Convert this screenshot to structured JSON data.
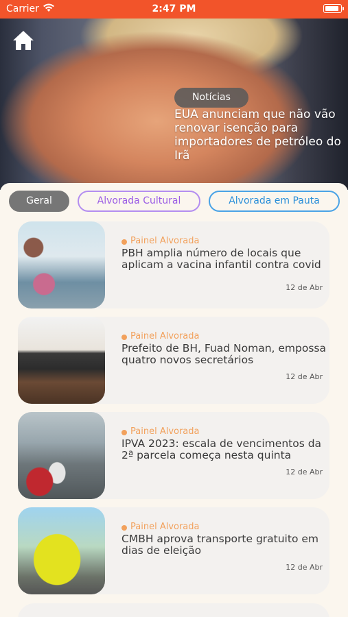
{
  "status_bar": {
    "carrier": "Carrier",
    "time": "2:47 PM"
  },
  "hero": {
    "category": "Notícias",
    "headline": "EUA anunciam que não vão renovar isenção para importadores de petróleo do Irã"
  },
  "filters": [
    {
      "label": "Geral",
      "selected": true
    },
    {
      "label": "Alvorada Cultural",
      "selected": false
    },
    {
      "label": "Alvorada em Pauta",
      "selected": false
    }
  ],
  "news": [
    {
      "source": "Painel Alvorada",
      "title": "PBH amplia número de locais que aplicam a vacina infantil contra covid",
      "date": "12 de Abr"
    },
    {
      "source": "Painel Alvorada",
      "title": "Prefeito de BH, Fuad Noman, empossa quatro novos secretários",
      "date": "12 de Abr"
    },
    {
      "source": "Painel Alvorada",
      "title": "IPVA 2023: escala de vencimentos da 2ª parcela começa nesta quinta",
      "date": "12 de Abr"
    },
    {
      "source": "Painel Alvorada",
      "title": "CMBH aprova transporte gratuito em dias de eleição",
      "date": "12 de Abr"
    }
  ],
  "colors": {
    "status_bar": "#f2542a",
    "source_accent": "#f2a15c",
    "filter_selected": "#767676",
    "filter_cultural": "#9b5de5",
    "filter_pauta": "#2b8fd9"
  },
  "icons": {
    "home": "home-icon",
    "wifi": "wifi-icon",
    "battery": "battery-icon"
  }
}
